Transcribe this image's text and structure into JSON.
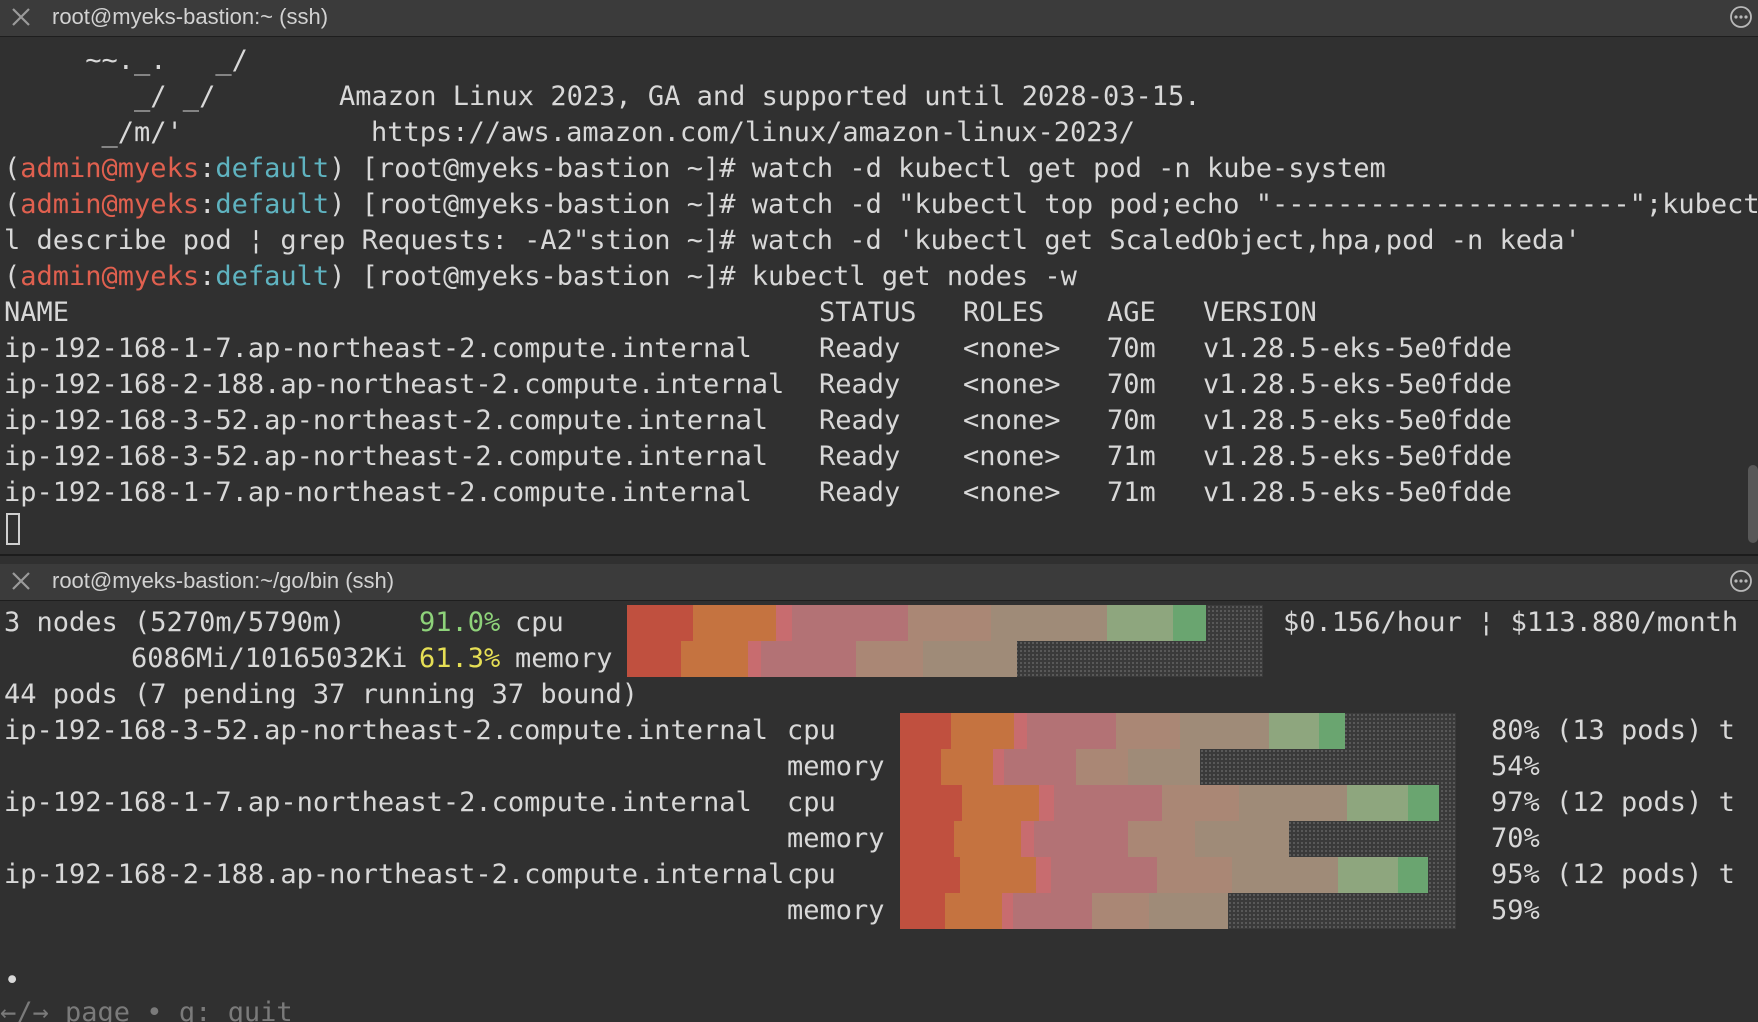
{
  "colors": {
    "segments": [
      "#c0503f",
      "#c57340",
      "#c86c6f",
      "#b37275",
      "#aa8775",
      "#9f8b78",
      "#8ea67e",
      "#6aa570"
    ],
    "accent_red": "#e0604f",
    "accent_cyan": "#5fb3c0"
  },
  "top_tab": {
    "title": "root@myeks-bastion:~ (ssh)",
    "close_icon": "close-icon",
    "more_icon": "more-icon"
  },
  "banner": {
    "art1": "     ~~._.   _/",
    "art2": "        _/ _/",
    "art3": "      _/m/'",
    "text1": "Amazon Linux 2023, GA and supported until 2028-03-15.",
    "text2": "https://aws.amazon.com/linux/amazon-linux-2023/"
  },
  "prompt": {
    "open": "(",
    "user": "admin@myeks",
    "sep": ":",
    "ns": "default",
    "close": ")",
    "host": " [root@myeks-bastion ~]# "
  },
  "commands": {
    "cmd1": "watch -d kubectl get pod -n kube-system",
    "cmd2": "watch -d \"kubectl top pod;echo \"----------------------\";kubect",
    "cmd2_wrap": "l describe pod ¦ grep Requests: -A2\"stion ~]# watch -d 'kubectl get ScaledObject,hpa,pod -n keda'",
    "cmd3": "kubectl get nodes -w"
  },
  "nodes_table": {
    "headers": [
      "NAME",
      "STATUS",
      "ROLES",
      "AGE",
      "VERSION"
    ],
    "rows": [
      [
        "ip-192-168-1-7.ap-northeast-2.compute.internal",
        "Ready",
        "<none>",
        "70m",
        "v1.28.5-eks-5e0fdde"
      ],
      [
        "ip-192-168-2-188.ap-northeast-2.compute.internal",
        "Ready",
        "<none>",
        "70m",
        "v1.28.5-eks-5e0fdde"
      ],
      [
        "ip-192-168-3-52.ap-northeast-2.compute.internal",
        "Ready",
        "<none>",
        "70m",
        "v1.28.5-eks-5e0fdde"
      ],
      [
        "ip-192-168-3-52.ap-northeast-2.compute.internal",
        "Ready",
        "<none>",
        "71m",
        "v1.28.5-eks-5e0fdde"
      ],
      [
        "ip-192-168-1-7.ap-northeast-2.compute.internal",
        "Ready",
        "<none>",
        "71m",
        "v1.28.5-eks-5e0fdde"
      ]
    ]
  },
  "bottom_tab": {
    "title": "root@myeks-bastion:~/go/bin (ssh)",
    "close_icon": "close-icon",
    "more_icon": "more-icon"
  },
  "summary": {
    "nodes_text": "3 nodes (5270m/5790m)",
    "cpu_pct": "91.0%",
    "cpu_label": "cpu",
    "cpu_fraction": 0.91,
    "mem_text": "6086Mi/10165032Ki",
    "mem_pct": "61.3%",
    "mem_label": "memory",
    "mem_fraction": 0.613,
    "cost": "$0.156/hour ¦ $113.880/month",
    "pods_text": "44 pods (7 pending 37 running 37 bound)"
  },
  "node_usage": [
    {
      "name": "ip-192-168-3-52.ap-northeast-2.compute.internal",
      "cpu_label": "cpu",
      "cpu_value": "80% (13 pods) t",
      "cpu_fraction": 0.8,
      "mem_label": "memory",
      "mem_value": "54%",
      "mem_fraction": 0.54
    },
    {
      "name": "ip-192-168-1-7.ap-northeast-2.compute.internal",
      "cpu_label": "cpu",
      "cpu_value": "97% (12 pods) t",
      "cpu_fraction": 0.97,
      "mem_label": "memory",
      "mem_value": "70%",
      "mem_fraction": 0.7
    },
    {
      "name": "ip-192-168-2-188.ap-northeast-2.compute.internal",
      "cpu_label": "cpu",
      "cpu_value": "95% (12 pods) t",
      "cpu_fraction": 0.95,
      "mem_label": "memory",
      "mem_value": "59%",
      "mem_fraction": 0.59
    }
  ],
  "footer": {
    "dot": "•",
    "hint": "←/→ page • q: quit"
  }
}
